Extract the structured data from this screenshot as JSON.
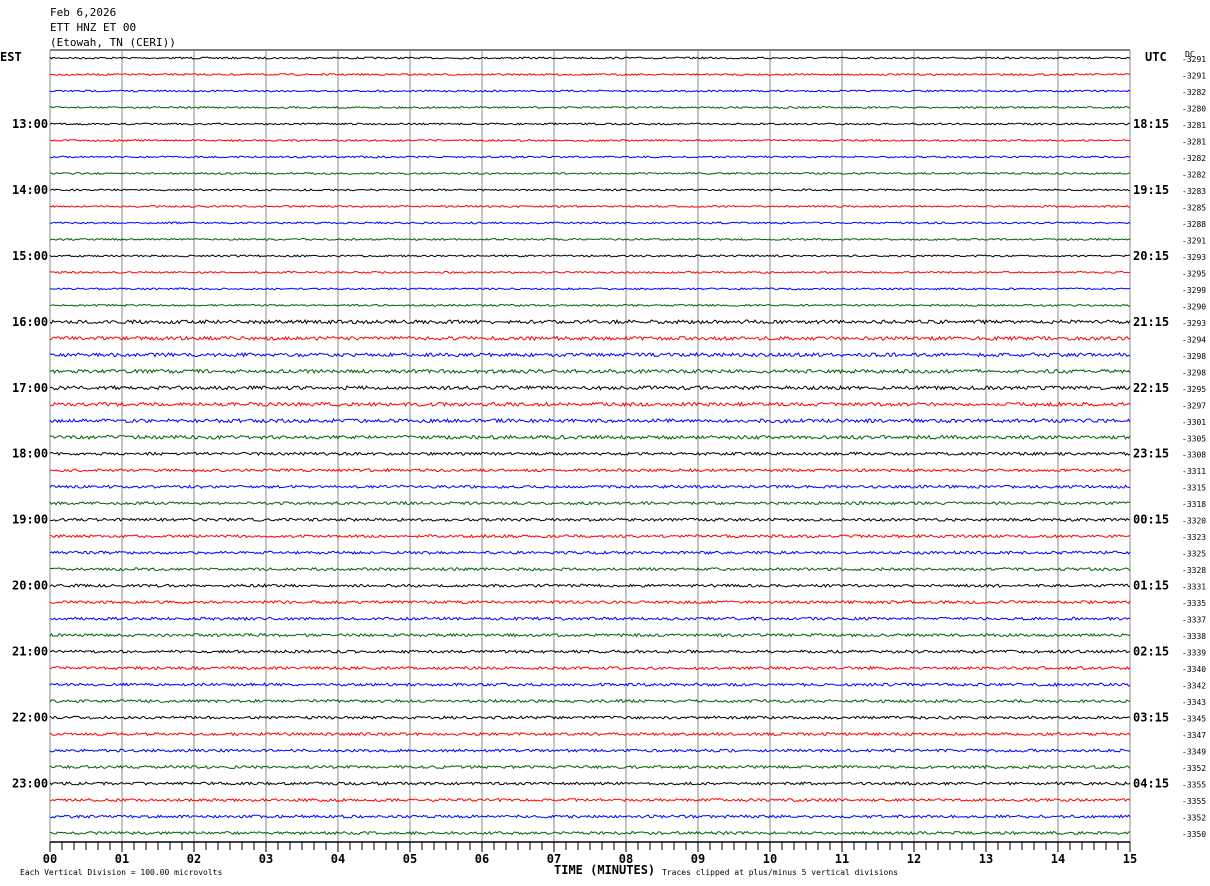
{
  "header": {
    "date": "Feb 6,2026",
    "station": "ETT HNZ ET 00",
    "location": "(Etowah, TN (CERI))"
  },
  "left_tz": "EST",
  "right_tz": "UTC",
  "dc_label": "DC",
  "footer": {
    "scale": "Each Vertical Division =  100.00 microvolts",
    "xlabel": "TIME (MINUTES)",
    "clip": "Traces clipped at plus/minus 5 vertical divisions"
  },
  "chart_data": {
    "type": "line",
    "title": "ETT HNZ ET 00 helicorder",
    "xlabel": "TIME (MINUTES)",
    "xlim": [
      0,
      15
    ],
    "x_ticks": [
      "00",
      "01",
      "02",
      "03",
      "04",
      "05",
      "06",
      "07",
      "08",
      "09",
      "10",
      "11",
      "12",
      "13",
      "14",
      "15"
    ],
    "trace_colors": [
      "#000000",
      "#ff0000",
      "#0000ff",
      "#006400"
    ],
    "left_hour_labels": [
      "13:00",
      "14:00",
      "15:00",
      "16:00",
      "17:00",
      "18:00",
      "19:00",
      "20:00",
      "21:00",
      "22:00",
      "23:00"
    ],
    "right_hour_labels": [
      "18:15",
      "19:15",
      "20:15",
      "21:15",
      "22:15",
      "23:15",
      "00:15",
      "01:15",
      "02:15",
      "03:15",
      "04:15"
    ],
    "dc_offsets": [
      -3291,
      -3291,
      -3282,
      -3280,
      -3281,
      -3281,
      -3282,
      -3282,
      -3283,
      -3285,
      -3288,
      -3291,
      -3293,
      -3295,
      -3299,
      -3290,
      -3293,
      -3294,
      -3298,
      -3298,
      -3295,
      -3297,
      -3301,
      -3305,
      -3308,
      -3311,
      -3315,
      -3318,
      -3320,
      -3323,
      -3325,
      -3328,
      -3331,
      -3335,
      -3337,
      -3338,
      -3339,
      -3340,
      -3342,
      -3343,
      -3345,
      -3347,
      -3349,
      -3352,
      -3355,
      -3355,
      -3352,
      -3350
    ]
  }
}
